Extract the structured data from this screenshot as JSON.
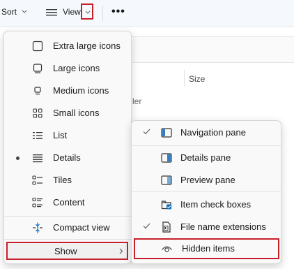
{
  "toolbar": {
    "sort_label": "Sort",
    "view_label": "View",
    "more_label": "•••"
  },
  "background": {
    "size_column": "Size",
    "folder_text": "ler"
  },
  "view_menu": {
    "items": [
      {
        "label": "Extra large icons",
        "icon": "extra-large-icons-icon"
      },
      {
        "label": "Large icons",
        "icon": "large-icons-icon"
      },
      {
        "label": "Medium icons",
        "icon": "medium-icons-icon"
      },
      {
        "label": "Small icons",
        "icon": "small-icons-icon"
      },
      {
        "label": "List",
        "icon": "list-icon"
      },
      {
        "label": "Details",
        "icon": "details-icon",
        "selected": true
      },
      {
        "label": "Tiles",
        "icon": "tiles-icon"
      },
      {
        "label": "Content",
        "icon": "content-icon"
      },
      {
        "label": "Compact view",
        "icon": "compact-view-icon"
      },
      {
        "label": "Show",
        "icon": "chevron-right-icon"
      }
    ]
  },
  "show_menu": {
    "items": [
      {
        "label": "Navigation pane",
        "icon": "navigation-pane-icon",
        "checked": true
      },
      {
        "label": "Details pane",
        "icon": "details-pane-icon",
        "checked": false
      },
      {
        "label": "Preview pane",
        "icon": "preview-pane-icon",
        "checked": false
      },
      {
        "label": "Item check boxes",
        "icon": "checkbox-icon",
        "checked": false
      },
      {
        "label": "File name extensions",
        "icon": "file-extension-icon",
        "checked": true
      },
      {
        "label": "Hidden items",
        "icon": "eye-icon",
        "checked": false
      }
    ]
  },
  "colors": {
    "highlight_border": "#c8202a",
    "accent": "#0a6cbd"
  }
}
